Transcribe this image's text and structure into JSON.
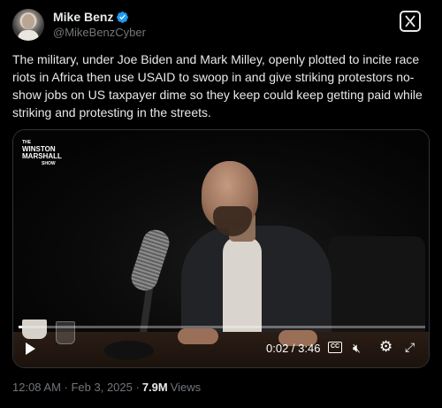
{
  "author": {
    "display_name": "Mike Benz",
    "handle": "@MikeBenzCyber",
    "verified": true
  },
  "tweet": {
    "text": "The military, under Joe Biden and Mark Milley, openly plotted to incite race riots in Africa then use USAID to swoop in and give striking protestors no-show jobs on US taxpayer dime so they keep could keep getting paid while striking and protesting in the streets."
  },
  "video": {
    "watermark_the": "THE",
    "watermark_main": "WINSTON MARSHALL",
    "watermark_show": "SHOW",
    "time_display": "0:02 / 3:46",
    "progress_fraction": 0.009,
    "cc_label": "CC"
  },
  "meta": {
    "timestamp": "12:08 AM · Feb 3, 2025 ·",
    "views_count": "7.9M",
    "views_label": "Views"
  },
  "colors": {
    "background": "#000000",
    "text_primary": "#e7e9ea",
    "text_secondary": "#71767b",
    "verified_blue": "#1d9bf0"
  }
}
